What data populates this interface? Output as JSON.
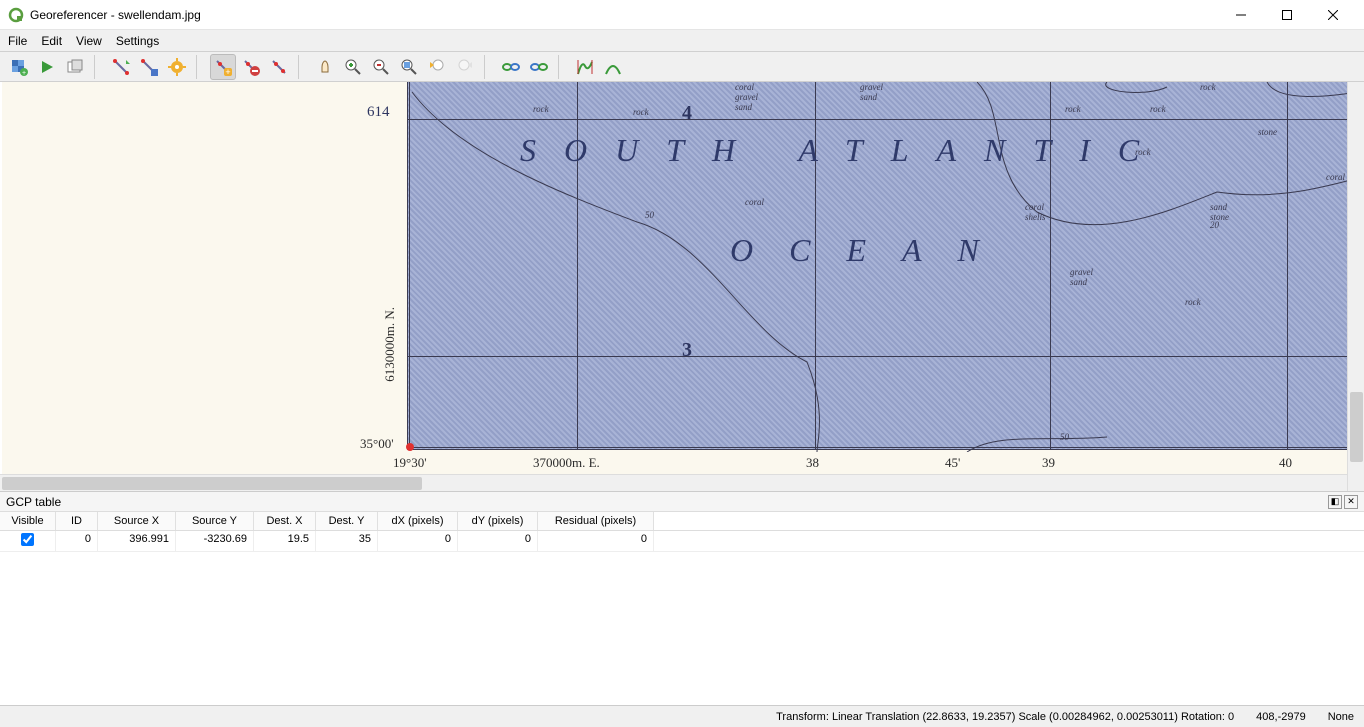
{
  "window": {
    "title": "Georeferencer - swellendam.jpg"
  },
  "menu": {
    "file": "File",
    "edit": "Edit",
    "view": "View",
    "settings": "Settings"
  },
  "toolbar_icons": {
    "open": "open-raster-icon",
    "start": "start-georef-icon",
    "script": "generate-script-icon",
    "load_gcp": "load-gcp-icon",
    "save_gcp": "save-gcp-icon",
    "settings": "transformation-settings-icon",
    "add_point": "add-point-icon",
    "del_point": "delete-point-icon",
    "move_point": "move-point-icon",
    "pan": "pan-icon",
    "zoom_in": "zoom-in-icon",
    "zoom_out": "zoom-out-icon",
    "zoom_layer": "zoom-to-layer-icon",
    "zoom_last": "zoom-last-icon",
    "zoom_next": "zoom-next-icon",
    "link_georef": "link-georef-to-qgis-icon",
    "link_qgis": "link-qgis-to-georef-icon",
    "hist": "full-histogram-icon",
    "hist_local": "local-histogram-icon"
  },
  "map": {
    "title_line1": "SOUTH  ATLANTIC",
    "title_line2": "OCEAN",
    "labels": {
      "rock1": "rock",
      "rock2": "rock",
      "rock3": "rock",
      "rock4": "rock",
      "rock5": "rock",
      "rock6": "rock",
      "gravel_sand1": "gravel\nsand",
      "coral_gravel_sand": "coral\ngravel\nsand",
      "coral1": "coral",
      "coral2": "coral",
      "coral_shells": "coral\nshells",
      "sand_stone": "sand\nstone",
      "gravel_sand2": "gravel\nsand",
      "stone": "stone",
      "iso50": "50",
      "iso50b": "50",
      "iso20": "20"
    },
    "gridnums": {
      "g3": "3",
      "g4": "4",
      "g614": "614"
    },
    "axis": {
      "lat_35": "35°00'",
      "lon_1930": "19°30'",
      "easting": "370000m. E.",
      "northing": "6130000m. N.",
      "lon_38": "38",
      "lon_45m": "45'",
      "lon_39": "39",
      "lon_40": "40"
    }
  },
  "gcp": {
    "panel_title": "GCP table",
    "headers": {
      "visible": "Visible",
      "id": "ID",
      "sx": "Source X",
      "sy": "Source Y",
      "dx": "Dest. X",
      "dy": "Dest. Y",
      "dpx": "dX (pixels)",
      "dpy": "dY (pixels)",
      "res": "Residual (pixels)"
    },
    "rows": [
      {
        "visible": true,
        "id": "0",
        "sx": "396.991",
        "sy": "-3230.69",
        "dx": "19.5",
        "dy": "35",
        "dpx": "0",
        "dpy": "0",
        "res": "0"
      }
    ]
  },
  "status": {
    "transform": "Transform: Linear Translation (22.8633, 19.2357) Scale (0.00284962, 0.00253011) Rotation: 0",
    "coords": "408,-2979",
    "eof": "None"
  }
}
